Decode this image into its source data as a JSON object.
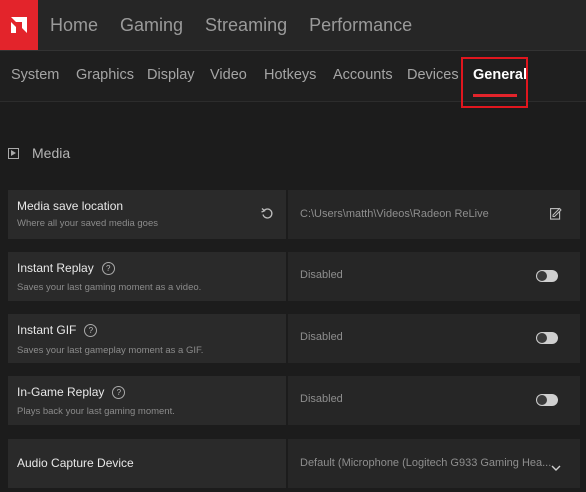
{
  "top_nav": [
    "Home",
    "Gaming",
    "Streaming",
    "Performance"
  ],
  "sub_tabs": [
    "System",
    "Graphics",
    "Display",
    "Video",
    "Hotkeys",
    "Accounts",
    "Devices",
    "General"
  ],
  "active_tab": "General",
  "section": {
    "title": "Media"
  },
  "settings": {
    "save_location": {
      "label": "Media save location",
      "description": "Where all your saved media goes",
      "value": "C:\\Users\\matth\\Videos\\Radeon ReLive"
    },
    "instant_replay": {
      "label": "Instant Replay",
      "description": "Saves your last gaming moment as a video.",
      "value": "Disabled"
    },
    "instant_gif": {
      "label": "Instant GIF",
      "description": "Saves your last gameplay moment as a GIF.",
      "value": "Disabled"
    },
    "in_game_replay": {
      "label": "In-Game Replay",
      "description": "Plays back your last gaming moment.",
      "value": "Disabled"
    },
    "audio_capture": {
      "label": "Audio Capture Device",
      "value": "Default (Microphone (Logitech G933 Gaming Hea..."
    }
  },
  "colors": {
    "accent": "#e3242b",
    "highlight_box": "#e0161e"
  }
}
